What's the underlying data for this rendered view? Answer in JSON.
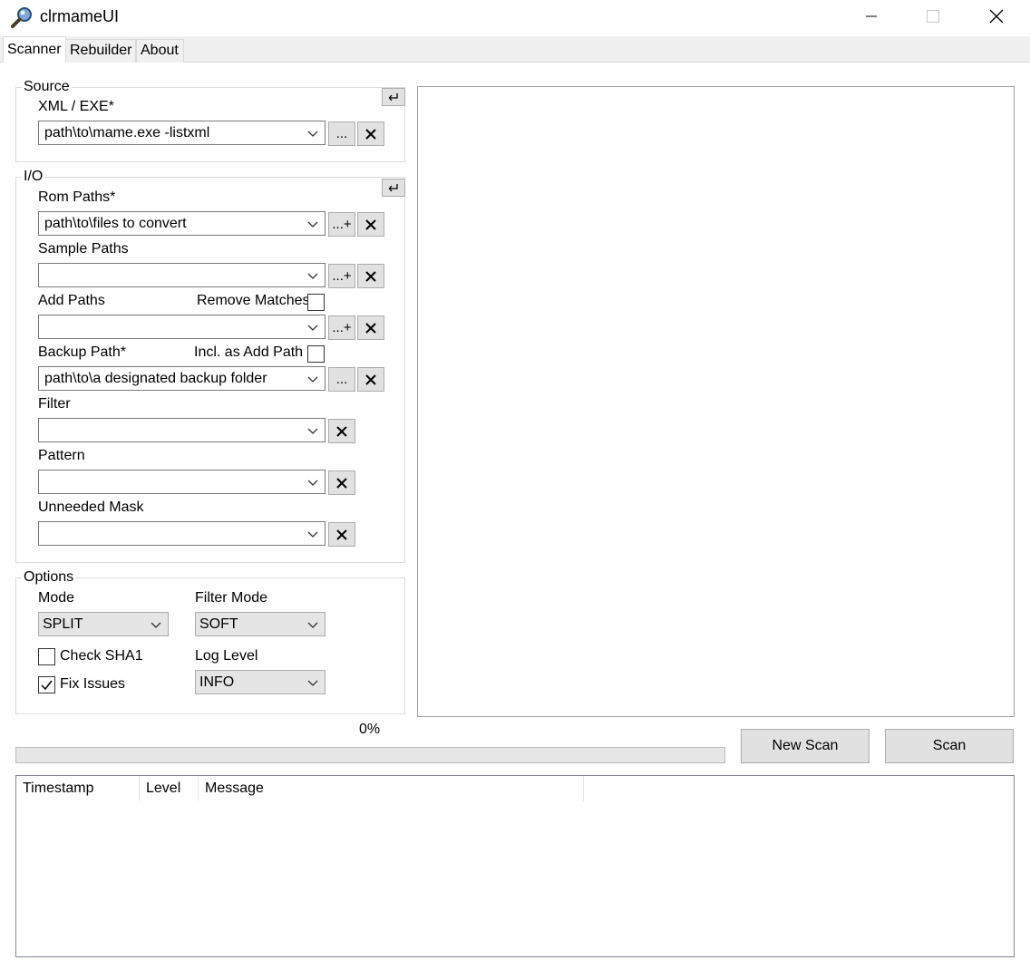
{
  "window": {
    "title": "clrmameUI"
  },
  "tabs": [
    {
      "label": "Scanner"
    },
    {
      "label": "Rebuilder"
    },
    {
      "label": "About"
    }
  ],
  "source": {
    "legend": "Source",
    "xml_label": "XML / EXE*",
    "xml_value": "path\\to\\mame.exe -listxml",
    "browse_label": "..."
  },
  "io": {
    "legend": "I/O",
    "rom_paths": {
      "label": "Rom Paths*",
      "value": "path\\to\\files to convert",
      "add_label": "...+"
    },
    "sample_paths": {
      "label": "Sample Paths",
      "value": "",
      "add_label": "...+"
    },
    "add_paths": {
      "label": "Add Paths",
      "value": "",
      "add_label": "...+",
      "remove_matches_label": "Remove Matches",
      "remove_matches_checked": false
    },
    "backup_path": {
      "label": "Backup Path*",
      "value": "path\\to\\a designated backup folder",
      "browse_label": "...",
      "incl_label": "Incl. as Add Path",
      "incl_checked": false
    },
    "filter": {
      "label": "Filter",
      "value": ""
    },
    "pattern": {
      "label": "Pattern",
      "value": ""
    },
    "unneeded_mask": {
      "label": "Unneeded Mask",
      "value": ""
    }
  },
  "options": {
    "legend": "Options",
    "mode_label": "Mode",
    "mode_value": "SPLIT",
    "filter_mode_label": "Filter Mode",
    "filter_mode_value": "SOFT",
    "check_sha1_label": "Check SHA1",
    "check_sha1_checked": false,
    "fix_issues_label": "Fix Issues",
    "fix_issues_checked": true,
    "log_level_label": "Log Level",
    "log_level_value": "INFO"
  },
  "progress": {
    "text": "0%",
    "value": 0
  },
  "actions": {
    "new_scan_label": "New Scan",
    "scan_label": "Scan"
  },
  "log": {
    "columns": [
      "Timestamp",
      "Level",
      "Message"
    ],
    "rows": []
  },
  "icons": {
    "app": "magnifier-app-icon",
    "clear": "x-icon",
    "reset": "return-arrow-icon",
    "dropdown": "chevron-down-icon",
    "check": "checkmark-icon"
  },
  "colors": {
    "progress_fill": "#06b025",
    "button_face": "#e1e1e1",
    "tab_strip": "#f0f0f0"
  }
}
